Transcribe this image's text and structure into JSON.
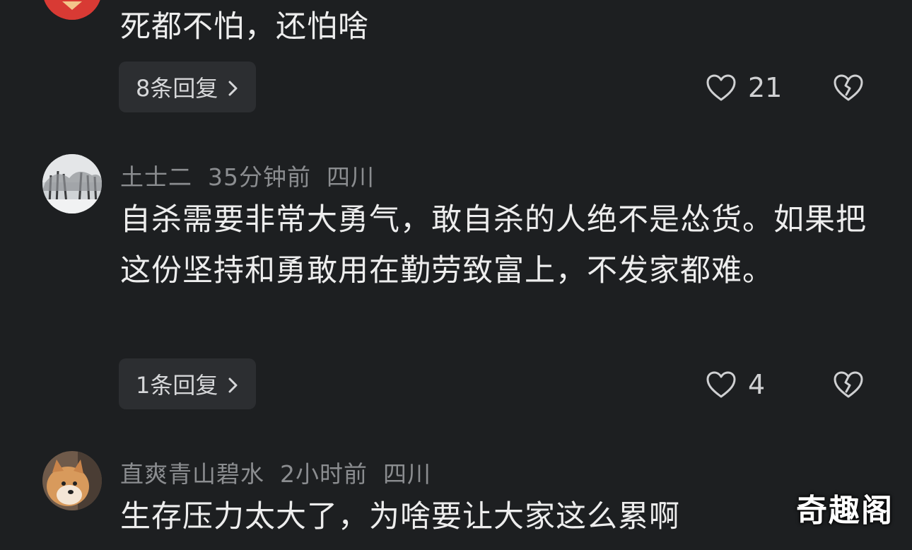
{
  "comments": [
    {
      "author": "",
      "time": "",
      "location": "",
      "content": "死都不怕，还怕啥",
      "reply_label": "8条回复",
      "likes": "21",
      "avatar_icon": "avatar-partial-red"
    },
    {
      "author": "土士二",
      "time": "35分钟前",
      "location": "四川",
      "content": "自杀需要非常大勇气，敢自杀的人绝不是怂货。如果把这份坚持和勇敢用在勤劳致富上，不发家都难。",
      "reply_label": "1条回复",
      "likes": "4",
      "avatar_icon": "avatar-snowy-trees"
    },
    {
      "author": "直爽青山碧水",
      "time": "2小时前",
      "location": "四川",
      "content": "生存压力太大了，为啥要让大家这么累啊",
      "avatar_icon": "avatar-shiba-dog"
    }
  ],
  "watermark": "奇趣阁",
  "icons": {
    "like": "heart-outline-icon",
    "dislike": "broken-heart-icon",
    "reply_chevron": "chevron-right-icon"
  },
  "colors": {
    "background": "#1d1f21",
    "reply_button_bg": "#2c2e31",
    "meta_text": "#8b8d90",
    "main_text": "#ededed"
  }
}
